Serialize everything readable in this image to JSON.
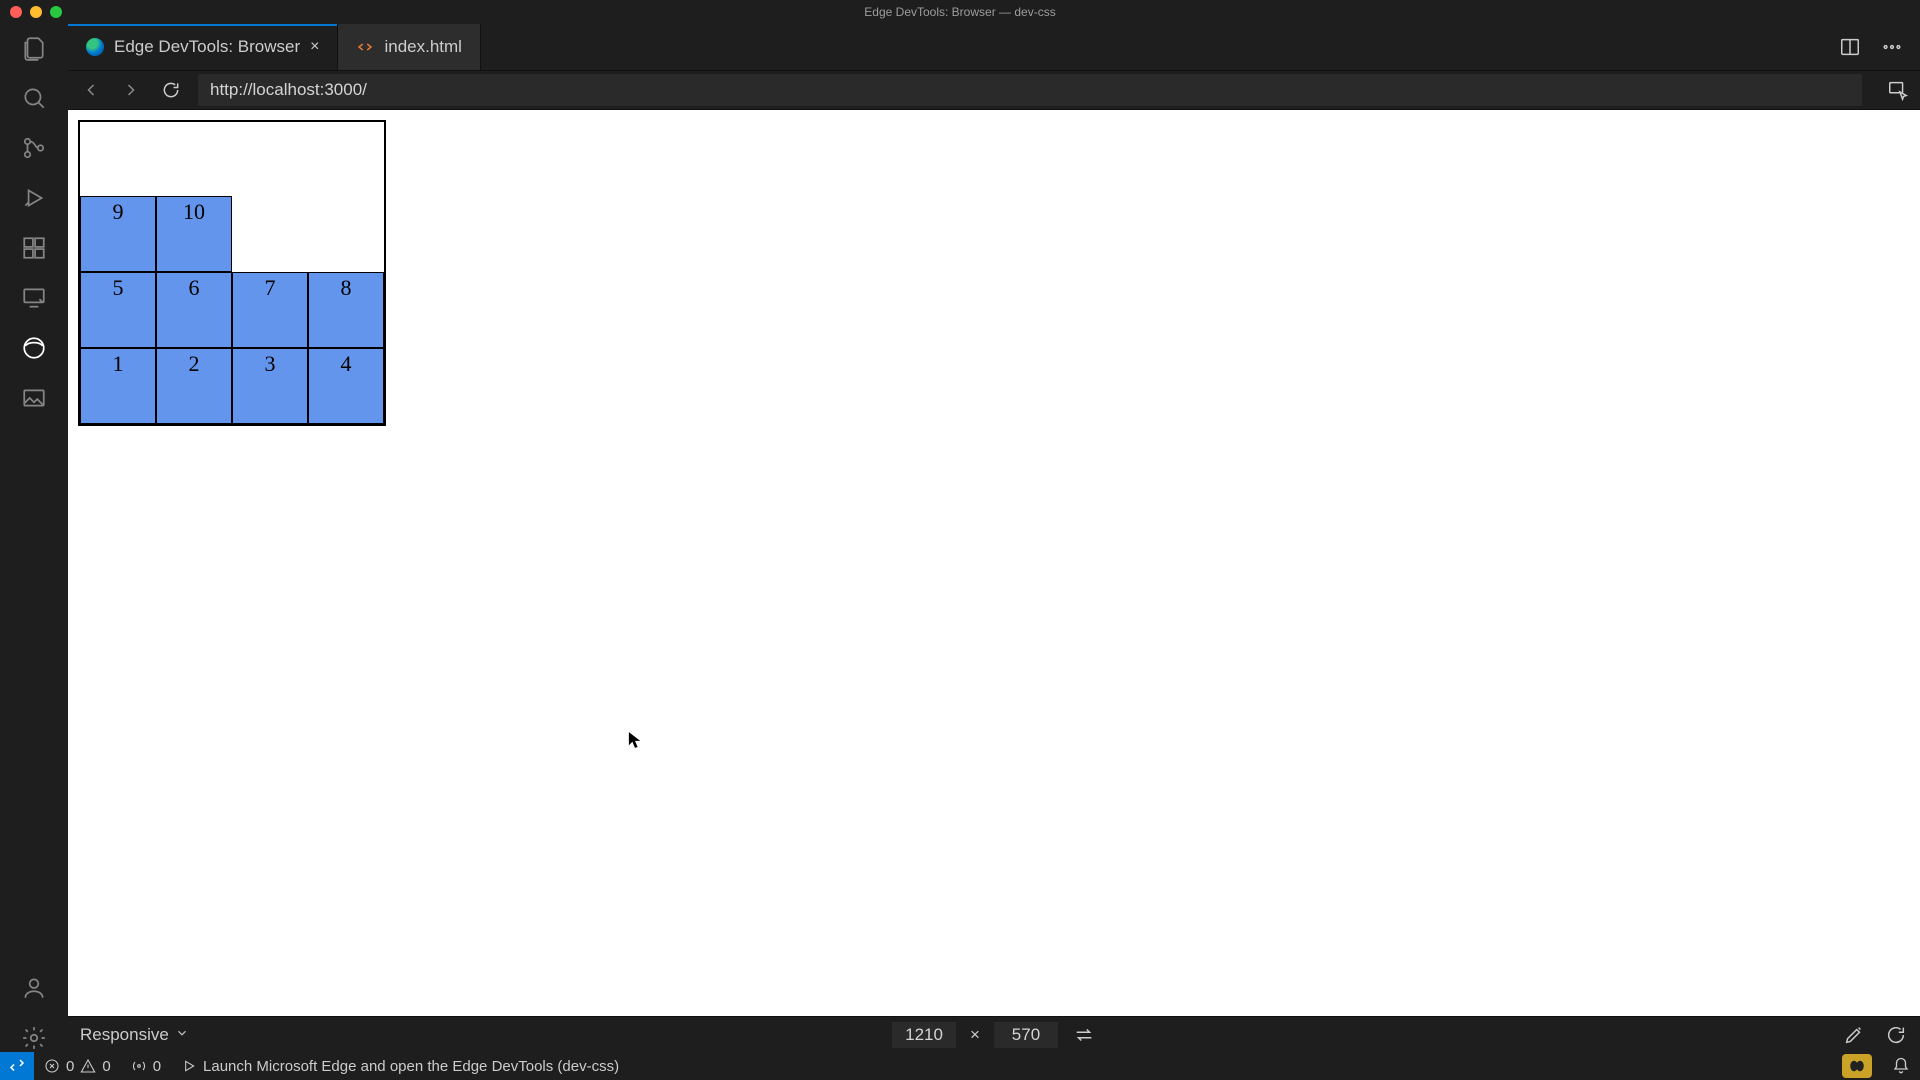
{
  "window": {
    "title": "Edge DevTools: Browser — dev-css"
  },
  "tabs": {
    "active": {
      "label": "Edge DevTools: Browser"
    },
    "second": {
      "label": "index.html"
    }
  },
  "address": {
    "url": "http://localhost:3000/"
  },
  "flex_demo": {
    "cells": [
      "1",
      "2",
      "3",
      "4",
      "5",
      "6",
      "7",
      "8",
      "9",
      "10"
    ]
  },
  "responsive": {
    "mode": "Responsive",
    "width": "1210",
    "sep": "×",
    "height": "570"
  },
  "status": {
    "errors": "0",
    "warnings": "0",
    "ports": "0",
    "launch": "Launch Microsoft Edge and open the Edge DevTools (dev-css)"
  }
}
